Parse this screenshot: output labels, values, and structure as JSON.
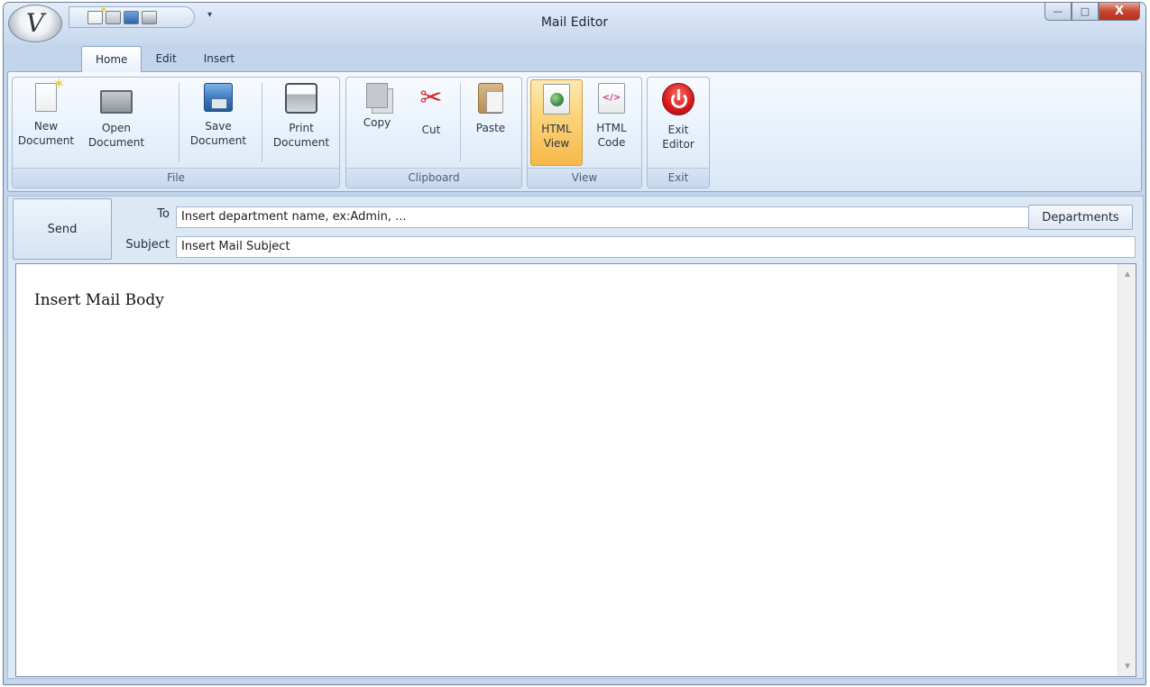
{
  "window": {
    "title": "Mail Editor",
    "app_logo_text": "V"
  },
  "quick_access": {
    "items": [
      "new-icon",
      "open-icon",
      "save-icon",
      "print-icon"
    ],
    "dropdown": "▾"
  },
  "window_controls": {
    "minimize": "—",
    "maximize": "□",
    "close": "X"
  },
  "ribbon": {
    "tabs": [
      {
        "label": "Home",
        "active": true
      },
      {
        "label": "Edit",
        "active": false
      },
      {
        "label": "Insert",
        "active": false
      }
    ],
    "groups": {
      "file": {
        "label": "File",
        "new": "New\nDocument",
        "open": "Open\nDocument",
        "save": "Save\nDocument",
        "print": "Print\nDocument"
      },
      "clipboard": {
        "label": "Clipboard",
        "copy": "Copy",
        "cut": "Cut",
        "paste": "Paste"
      },
      "view": {
        "label": "View",
        "html_view": "HTML\nView",
        "html_code": "HTML\nCode",
        "html_code_glyph": "</>"
      },
      "exit": {
        "label": "Exit",
        "exit_editor": "Exit\nEditor"
      }
    }
  },
  "mail": {
    "send_label": "Send",
    "to_label": "To",
    "to_value": "Insert department name, ex:Admin, ...",
    "subject_label": "Subject",
    "subject_value": "Insert Mail Subject",
    "departments_label": "Departments",
    "body_text": "Insert Mail Body"
  },
  "scrollbar": {
    "up": "▲",
    "down": "▼"
  }
}
